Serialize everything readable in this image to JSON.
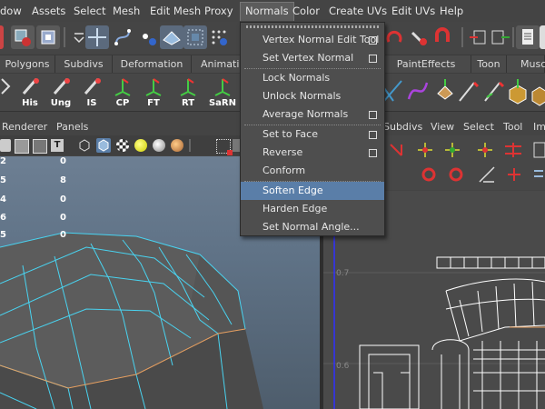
{
  "menubar": {
    "items": [
      "dow",
      "Assets",
      "Select",
      "Mesh",
      "Edit Mesh",
      "Proxy",
      "Normals",
      "Color",
      "Create UVs",
      "Edit UVs",
      "Help"
    ],
    "active": "Normals"
  },
  "shelf_tabs": [
    "Polygons",
    "Subdivs",
    "Deformation",
    "Animatio",
    "PaintEffects",
    "Toon",
    "Muscl"
  ],
  "shelf_buttons": [
    "His",
    "Ung",
    "IS",
    "CP",
    "FT",
    "RT",
    "SaRN"
  ],
  "panel_menu_left": [
    "Renderer",
    "Panels"
  ],
  "panel_menu_right": [
    "Subdivs",
    "View",
    "Select",
    "Tool",
    "Im"
  ],
  "hud_rows": [
    {
      "a": "2",
      "b": "0"
    },
    {
      "a": "5",
      "b": "8"
    },
    {
      "a": "4",
      "b": "0"
    },
    {
      "a": "6",
      "b": "0"
    },
    {
      "a": "5",
      "b": "0"
    }
  ],
  "uv_ticks": [
    "0.7",
    "0.6"
  ],
  "normals_menu": {
    "items": [
      {
        "label": "Vertex Normal Edit Tool",
        "option": true
      },
      {
        "label": "Set Vertex Normal",
        "option": true
      },
      {
        "label": "Lock Normals",
        "option": false
      },
      {
        "label": "Unlock Normals",
        "option": false
      },
      {
        "label": "Average Normals",
        "option": true
      },
      {
        "label": "Set to Face",
        "option": true
      },
      {
        "label": "Reverse",
        "option": true
      },
      {
        "label": "Conform",
        "option": false
      },
      {
        "label": "Soften Edge",
        "option": false,
        "highlighted": true
      },
      {
        "label": "Harden Edge",
        "option": false
      },
      {
        "label": "Set Normal Angle...",
        "option": false
      }
    ]
  },
  "colors": {
    "menu_highlight": "#5a7ea8",
    "wire": "#49d3f0",
    "viewport_top": "#6d7f93"
  }
}
